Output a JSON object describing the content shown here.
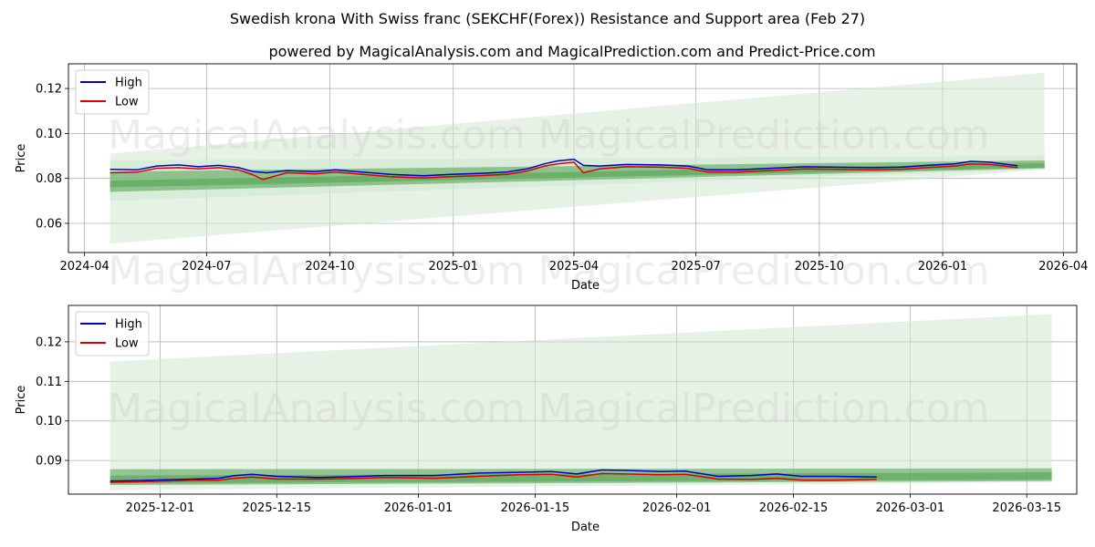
{
  "page": {
    "title_line1": "Swedish krona With Swiss franc (SEKCHF(Forex)) Resistance and Support area (Feb 27)",
    "title_line2": "powered by MagicalAnalysis.com and MagicalPrediction.com and Predict-Price.com",
    "watermark_left": "MagicalAnalysis.com",
    "watermark_right": "MagicalPrediction.com"
  },
  "colors": {
    "high": "#0000cc",
    "low": "#dd0000",
    "band_light": "#cfe8cf",
    "band_dark": "#4ea04e",
    "grid": "#b0b0b0"
  },
  "chart_data": [
    {
      "type": "line",
      "xlabel": "Date",
      "ylabel": "Price",
      "grid": true,
      "legend": "top-left",
      "x_range": [
        "2024-03-20",
        "2026-04-11"
      ],
      "ylim": [
        0.047,
        0.131
      ],
      "x_ticks": [
        "2024-04",
        "2024-07",
        "2024-10",
        "2025-01",
        "2025-04",
        "2025-07",
        "2025-10",
        "2026-01",
        "2026-04"
      ],
      "y_ticks": [
        "0.06",
        "0.08",
        "0.10",
        "0.12"
      ],
      "series": [
        {
          "name": "High",
          "points": [
            [
              "2024-04-20",
              0.084
            ],
            [
              "2024-05-10",
              0.0838
            ],
            [
              "2024-05-25",
              0.0855
            ],
            [
              "2024-06-10",
              0.086
            ],
            [
              "2024-06-25",
              0.0852
            ],
            [
              "2024-07-10",
              0.0858
            ],
            [
              "2024-07-25",
              0.0848
            ],
            [
              "2024-08-05",
              0.083
            ],
            [
              "2024-08-15",
              0.0825
            ],
            [
              "2024-08-30",
              0.0835
            ],
            [
              "2024-09-20",
              0.083
            ],
            [
              "2024-10-05",
              0.0838
            ],
            [
              "2024-10-25",
              0.0828
            ],
            [
              "2024-11-15",
              0.0818
            ],
            [
              "2024-12-10",
              0.0812
            ],
            [
              "2024-12-30",
              0.0818
            ],
            [
              "2025-01-20",
              0.0822
            ],
            [
              "2025-02-10",
              0.0828
            ],
            [
              "2025-02-25",
              0.0842
            ],
            [
              "2025-03-10",
              0.0865
            ],
            [
              "2025-03-20",
              0.0878
            ],
            [
              "2025-04-01",
              0.0885
            ],
            [
              "2025-04-08",
              0.0858
            ],
            [
              "2025-04-20",
              0.0855
            ],
            [
              "2025-05-10",
              0.0862
            ],
            [
              "2025-06-05",
              0.086
            ],
            [
              "2025-06-25",
              0.0855
            ],
            [
              "2025-07-10",
              0.0838
            ],
            [
              "2025-08-01",
              0.0838
            ],
            [
              "2025-08-25",
              0.0845
            ],
            [
              "2025-09-20",
              0.0852
            ],
            [
              "2025-10-15",
              0.085
            ],
            [
              "2025-11-10",
              0.0848
            ],
            [
              "2025-12-01",
              0.085
            ],
            [
              "2025-12-20",
              0.0858
            ],
            [
              "2026-01-10",
              0.0865
            ],
            [
              "2026-01-22",
              0.0876
            ],
            [
              "2026-02-05",
              0.0872
            ],
            [
              "2026-02-26",
              0.0856
            ]
          ]
        },
        {
          "name": "Low",
          "points": [
            [
              "2024-04-20",
              0.0825
            ],
            [
              "2024-05-10",
              0.0828
            ],
            [
              "2024-05-25",
              0.0845
            ],
            [
              "2024-06-10",
              0.0848
            ],
            [
              "2024-06-25",
              0.0842
            ],
            [
              "2024-07-10",
              0.0848
            ],
            [
              "2024-07-25",
              0.0838
            ],
            [
              "2024-08-05",
              0.0815
            ],
            [
              "2024-08-12",
              0.0795
            ],
            [
              "2024-08-30",
              0.0825
            ],
            [
              "2024-09-20",
              0.082
            ],
            [
              "2024-10-05",
              0.0828
            ],
            [
              "2024-10-25",
              0.0818
            ],
            [
              "2024-11-15",
              0.0808
            ],
            [
              "2024-12-10",
              0.0802
            ],
            [
              "2024-12-30",
              0.0808
            ],
            [
              "2025-01-20",
              0.0812
            ],
            [
              "2025-02-10",
              0.0818
            ],
            [
              "2025-02-25",
              0.0832
            ],
            [
              "2025-03-10",
              0.0855
            ],
            [
              "2025-03-20",
              0.0865
            ],
            [
              "2025-04-01",
              0.0872
            ],
            [
              "2025-04-08",
              0.0825
            ],
            [
              "2025-04-20",
              0.0842
            ],
            [
              "2025-05-10",
              0.0852
            ],
            [
              "2025-06-05",
              0.085
            ],
            [
              "2025-06-25",
              0.0845
            ],
            [
              "2025-07-10",
              0.0828
            ],
            [
              "2025-08-01",
              0.0828
            ],
            [
              "2025-08-25",
              0.0835
            ],
            [
              "2025-09-20",
              0.0842
            ],
            [
              "2025-10-15",
              0.084
            ],
            [
              "2025-11-10",
              0.0838
            ],
            [
              "2025-12-01",
              0.084
            ],
            [
              "2025-12-20",
              0.0848
            ],
            [
              "2026-01-10",
              0.0855
            ],
            [
              "2026-01-22",
              0.0865
            ],
            [
              "2026-02-05",
              0.0862
            ],
            [
              "2026-02-26",
              0.0848
            ]
          ]
        }
      ],
      "bands": [
        {
          "style": "light",
          "start_date": "2024-04-20",
          "end_date": "2026-03-18",
          "start": [
            0.051,
            0.091
          ],
          "end": [
            0.084,
            0.127
          ]
        },
        {
          "style": "light",
          "start_date": "2024-04-20",
          "end_date": "2026-03-18",
          "start": [
            0.07,
            0.088
          ],
          "end": [
            0.084,
            0.09
          ]
        },
        {
          "style": "dark",
          "start_date": "2024-04-20",
          "end_date": "2026-03-18",
          "start": [
            0.074,
            0.083
          ],
          "end": [
            0.0845,
            0.088
          ]
        },
        {
          "style": "dark",
          "start_date": "2024-04-20",
          "end_date": "2026-03-18",
          "start": [
            0.076,
            0.079
          ],
          "end": [
            0.0848,
            0.0868
          ]
        }
      ]
    },
    {
      "type": "line",
      "xlabel": "Date",
      "ylabel": "Price",
      "grid": true,
      "legend": "top-left",
      "x_range": [
        "2025-11-20",
        "2026-03-21"
      ],
      "ylim": [
        0.0815,
        0.1292
      ],
      "x_ticks": [
        "2025-12-01",
        "2025-12-15",
        "2026-01-01",
        "2026-01-15",
        "2026-02-01",
        "2026-02-15",
        "2026-03-01",
        "2026-03-15"
      ],
      "y_ticks": [
        "0.09",
        "0.10",
        "0.11",
        "0.12"
      ],
      "series": [
        {
          "name": "High",
          "points": [
            [
              "2025-11-25",
              0.0848
            ],
            [
              "2025-11-30",
              0.085
            ],
            [
              "2025-12-05",
              0.0853
            ],
            [
              "2025-12-08",
              0.0855
            ],
            [
              "2025-12-10",
              0.0862
            ],
            [
              "2025-12-12",
              0.0865
            ],
            [
              "2025-12-15",
              0.086
            ],
            [
              "2025-12-20",
              0.0857
            ],
            [
              "2025-12-25",
              0.086
            ],
            [
              "2025-12-28",
              0.0862
            ],
            [
              "2026-01-03",
              0.0862
            ],
            [
              "2026-01-08",
              0.0868
            ],
            [
              "2026-01-13",
              0.087
            ],
            [
              "2026-01-17",
              0.0872
            ],
            [
              "2026-01-20",
              0.0866
            ],
            [
              "2026-01-23",
              0.0876
            ],
            [
              "2026-01-26",
              0.0875
            ],
            [
              "2026-01-30",
              0.0872
            ],
            [
              "2026-02-02",
              0.0873
            ],
            [
              "2026-02-06",
              0.086
            ],
            [
              "2026-02-10",
              0.0862
            ],
            [
              "2026-02-13",
              0.0866
            ],
            [
              "2026-02-16",
              0.086
            ],
            [
              "2026-02-20",
              0.086
            ],
            [
              "2026-02-25",
              0.0858
            ]
          ]
        },
        {
          "name": "Low",
          "points": [
            [
              "2025-11-25",
              0.0845
            ],
            [
              "2025-11-30",
              0.0847
            ],
            [
              "2025-12-05",
              0.085
            ],
            [
              "2025-12-08",
              0.085
            ],
            [
              "2025-12-10",
              0.0855
            ],
            [
              "2025-12-12",
              0.0858
            ],
            [
              "2025-12-15",
              0.0853
            ],
            [
              "2025-12-20",
              0.0853
            ],
            [
              "2025-12-25",
              0.0855
            ],
            [
              "2025-12-28",
              0.0857
            ],
            [
              "2026-01-03",
              0.0855
            ],
            [
              "2026-01-08",
              0.086
            ],
            [
              "2026-01-13",
              0.0864
            ],
            [
              "2026-01-17",
              0.0865
            ],
            [
              "2026-01-20",
              0.0858
            ],
            [
              "2026-01-23",
              0.0867
            ],
            [
              "2026-01-26",
              0.0866
            ],
            [
              "2026-01-30",
              0.0864
            ],
            [
              "2026-02-02",
              0.0865
            ],
            [
              "2026-02-06",
              0.0853
            ],
            [
              "2026-02-10",
              0.0852
            ],
            [
              "2026-02-13",
              0.0855
            ],
            [
              "2026-02-16",
              0.085
            ],
            [
              "2026-02-20",
              0.085
            ],
            [
              "2026-02-25",
              0.0852
            ]
          ]
        }
      ],
      "bands": [
        {
          "style": "light",
          "start_date": "2025-11-25",
          "end_date": "2026-03-18",
          "start": [
            0.0825,
            0.115
          ],
          "end": [
            0.0845,
            0.127
          ]
        },
        {
          "style": "dark",
          "start_date": "2025-11-25",
          "end_date": "2026-03-18",
          "start": [
            0.0838,
            0.0878
          ],
          "end": [
            0.0848,
            0.088
          ]
        },
        {
          "style": "dark",
          "start_date": "2025-11-25",
          "end_date": "2026-03-18",
          "start": [
            0.0842,
            0.0862
          ],
          "end": [
            0.0852,
            0.087
          ]
        }
      ]
    }
  ]
}
